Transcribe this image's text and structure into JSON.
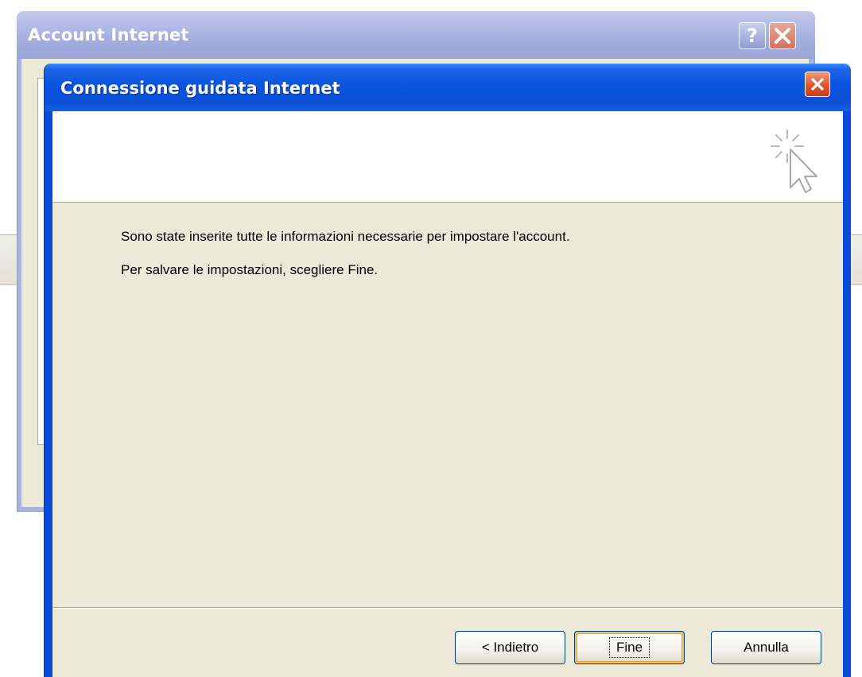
{
  "background_window": {
    "title": "Account Internet",
    "help_label": "?"
  },
  "wizard": {
    "title": "Connessione guidata Internet",
    "message_line1": "Sono state inserite tutte le informazioni necessarie per impostare l'account.",
    "message_line2": "Per salvare le impostazioni, scegliere Fine.",
    "header_icon": "wizard-cursor-icon",
    "buttons": {
      "back": "< Indietro",
      "finish": "Fine",
      "cancel": "Annulla"
    }
  },
  "colors": {
    "titlebar_blue": "#0a55e0",
    "close_red": "#e0552e",
    "dialog_face": "#ece9d8",
    "default_button_highlight": "#f9c05a"
  }
}
